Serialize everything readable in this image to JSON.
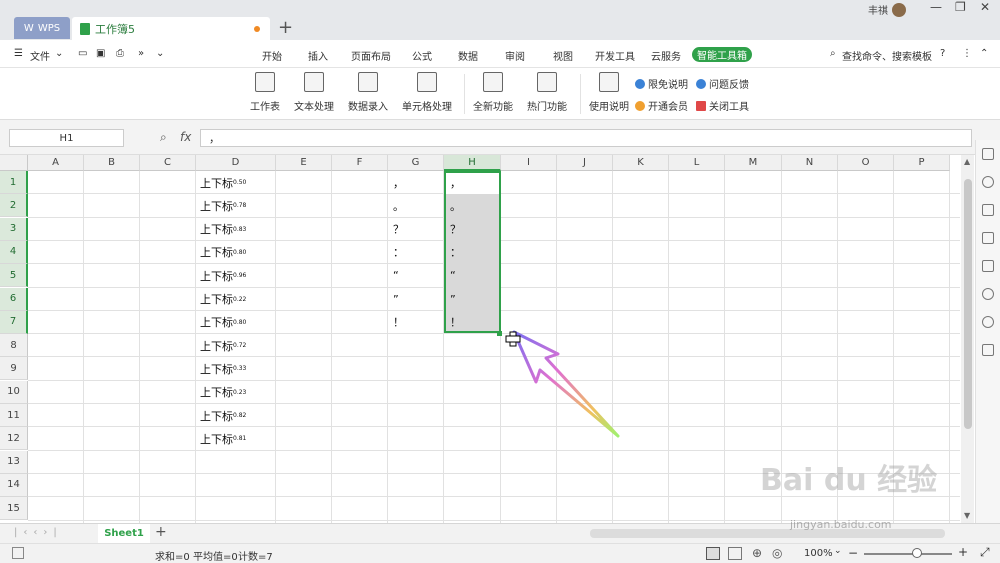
{
  "titlebar": {
    "wps_tab": "WPS",
    "doc_tab": "工作簿5",
    "new_tab": "+",
    "user_name": "丰祺"
  },
  "menu": {
    "file": "文件",
    "items": [
      "开始",
      "插入",
      "页面布局",
      "公式",
      "数据",
      "审阅",
      "视图",
      "开发工具",
      "云服务"
    ],
    "active": "智能工具箱",
    "search": "查找命令、搜索模板"
  },
  "ribbon": {
    "buttons": [
      "工作表",
      "文本处理",
      "数据录入",
      "单元格处理",
      "全新功能",
      "热门功能",
      "使用说明"
    ],
    "small": [
      "限免说明",
      "问题反馈",
      "开通会员",
      "关闭工具"
    ]
  },
  "formula_bar": {
    "cell_ref": "H1",
    "fx": "fx",
    "value": "，"
  },
  "grid": {
    "columns": [
      "A",
      "B",
      "C",
      "D",
      "E",
      "F",
      "G",
      "H",
      "I",
      "J",
      "K",
      "L",
      "M",
      "N",
      "O",
      "P"
    ],
    "rows": [
      "1",
      "2",
      "3",
      "4",
      "5",
      "6",
      "7",
      "8",
      "9",
      "10",
      "11",
      "12",
      "13",
      "14",
      "15"
    ],
    "d_prefix": "上下标",
    "d_values": [
      "0.50",
      "0.78",
      "0.83",
      "0.80",
      "0.96",
      "0.22",
      "0.80",
      "0.72",
      "0.33",
      "0.23",
      "0.82",
      "0.81"
    ],
    "g_values": [
      "，",
      "。",
      "？",
      "：",
      "“",
      "”",
      "！"
    ],
    "h_values": [
      "，",
      "。",
      "？",
      "：",
      "“",
      "”",
      "！"
    ]
  },
  "sheets": {
    "tab": "Sheet1",
    "add": "+"
  },
  "status": {
    "sum": "求和=0",
    "avg": "平均值=0",
    "count": "计数=7",
    "zoom": "100%"
  },
  "watermark": {
    "brand": "Bai du 经验",
    "url": "jingyan.baidu.com"
  }
}
